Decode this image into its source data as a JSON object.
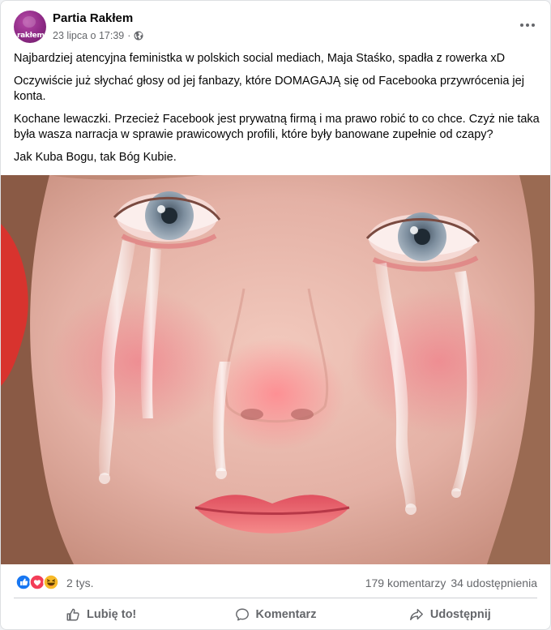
{
  "post": {
    "page_name": "Partia Rakłem",
    "avatar_label": "rakłem",
    "timestamp": "23 lipca o 17:39",
    "separator": "·",
    "privacy_icon": "globe-icon",
    "more_icon": "more-horizontal-icon",
    "paragraphs": [
      "Najbardziej atencyjna feministka w polskich social mediach, Maja Staśko, spadła z rowerka  xD",
      "Oczywiście już słychać głosy od jej fanbazy, które DOMAGAJĄ się od Facebooka przywrócenia jej konta.",
      "Kochane lewaczki. Przecież Facebook jest prywatną firmą i ma prawo robić to co chce. Czyż nie taka była wasza narracja w sprawie prawicowych profili, które były banowane zupełnie od czapy?",
      "Jak Kuba Bogu, tak Bóg Kubie."
    ],
    "photo_icon": "crying-face-photo"
  },
  "engagement": {
    "reaction_icons": [
      "like-icon",
      "love-icon",
      "haha-icon"
    ],
    "reaction_count": "2 tys.",
    "comments": "179 komentarzy",
    "shares": "34 udostępnienia"
  },
  "actions": {
    "like": {
      "label": "Lubię to!",
      "icon": "thumbs-up-icon"
    },
    "comment": {
      "label": "Komentarz",
      "icon": "comment-icon"
    },
    "share": {
      "label": "Udostępnij",
      "icon": "share-icon"
    }
  },
  "colors": {
    "text_primary": "#050505",
    "text_secondary": "#65676b",
    "like_blue": "#1877f2",
    "love_red": "#f33e58",
    "haha_yellow": "#f7b928",
    "avatar_purple": "#8e2a86"
  }
}
